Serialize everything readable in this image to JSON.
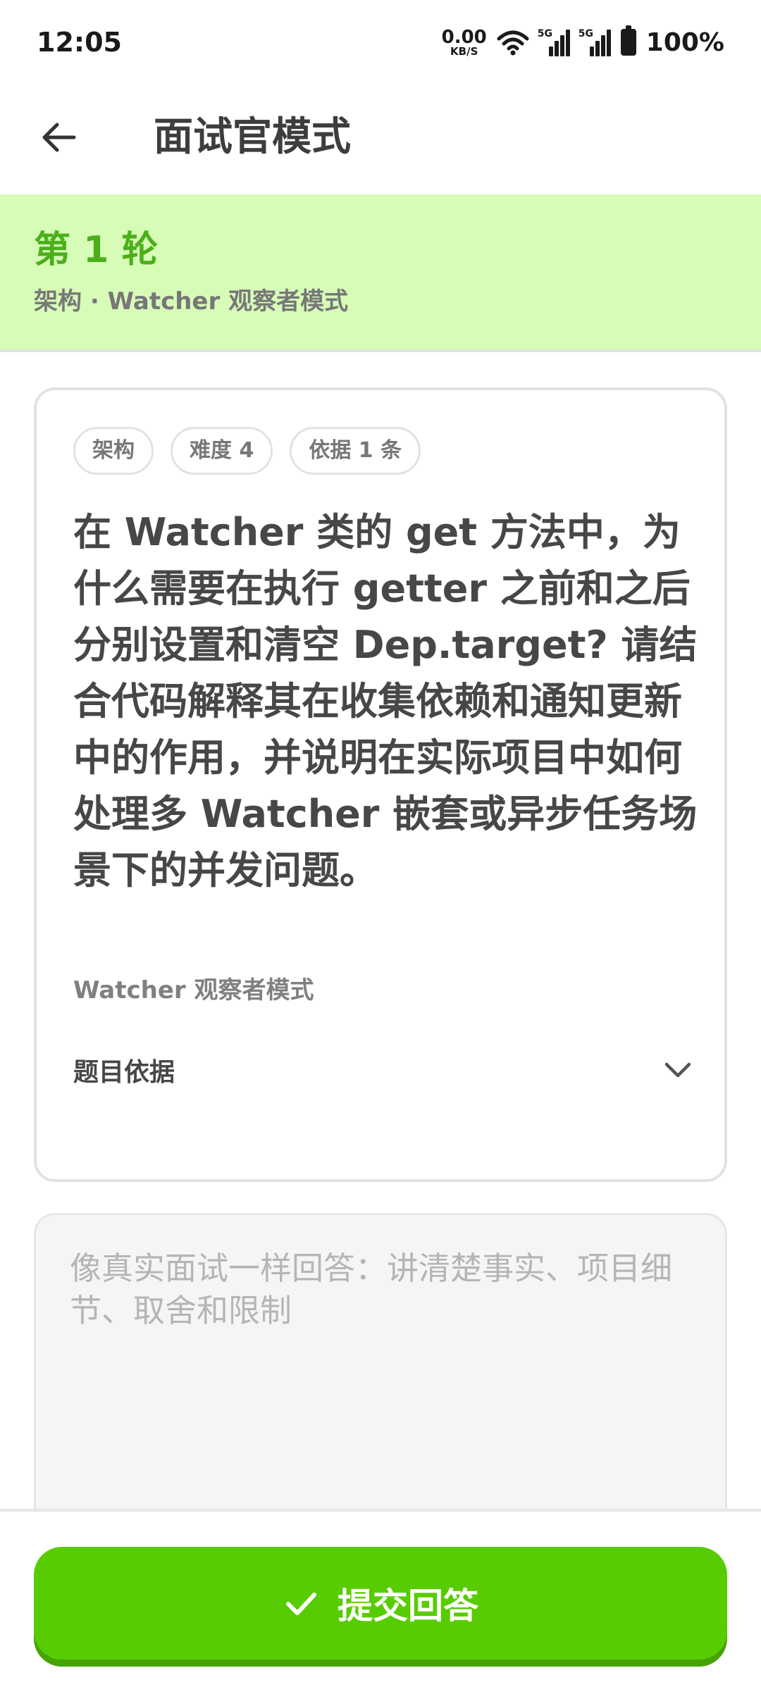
{
  "status_bar": {
    "time": "12:05",
    "net_speed_value": "0.00",
    "net_speed_unit": "KB/S",
    "signal1_label": "5G",
    "signal2_label": "5G",
    "battery_text": "100%"
  },
  "header": {
    "title": "面试官模式"
  },
  "round": {
    "title": "第 1 轮",
    "subtitle": "架构 · Watcher 观察者模式"
  },
  "question": {
    "chips": [
      "架构",
      "难度 4",
      "依据 1 条"
    ],
    "text": "在 Watcher 类的 get 方法中，为什么需要在执行 getter 之前和之后分别设置和清空 Dep.target? 请结合代码解释其在收集依赖和通知更新中的作用，并说明在实际项目中如何处理多 Watcher 嵌套或异步任务场景下的并发问题。",
    "topic": "Watcher 观察者模式",
    "basis_label": "题目依据"
  },
  "answer": {
    "placeholder": "像真实面试一样回答：讲清楚事实、项目细节、取舍和限制",
    "value": ""
  },
  "submit": {
    "label": "提交回答"
  },
  "icons": {
    "back": "arrow-left-icon",
    "expand": "chevron-down-icon",
    "submit": "check-icon",
    "wifi": "wifi-icon",
    "signal": "signal-icon",
    "battery": "battery-icon"
  },
  "colors": {
    "accent": "#58cc02",
    "banner_bg": "#d7fcb8",
    "round_title": "#4caf1a"
  }
}
